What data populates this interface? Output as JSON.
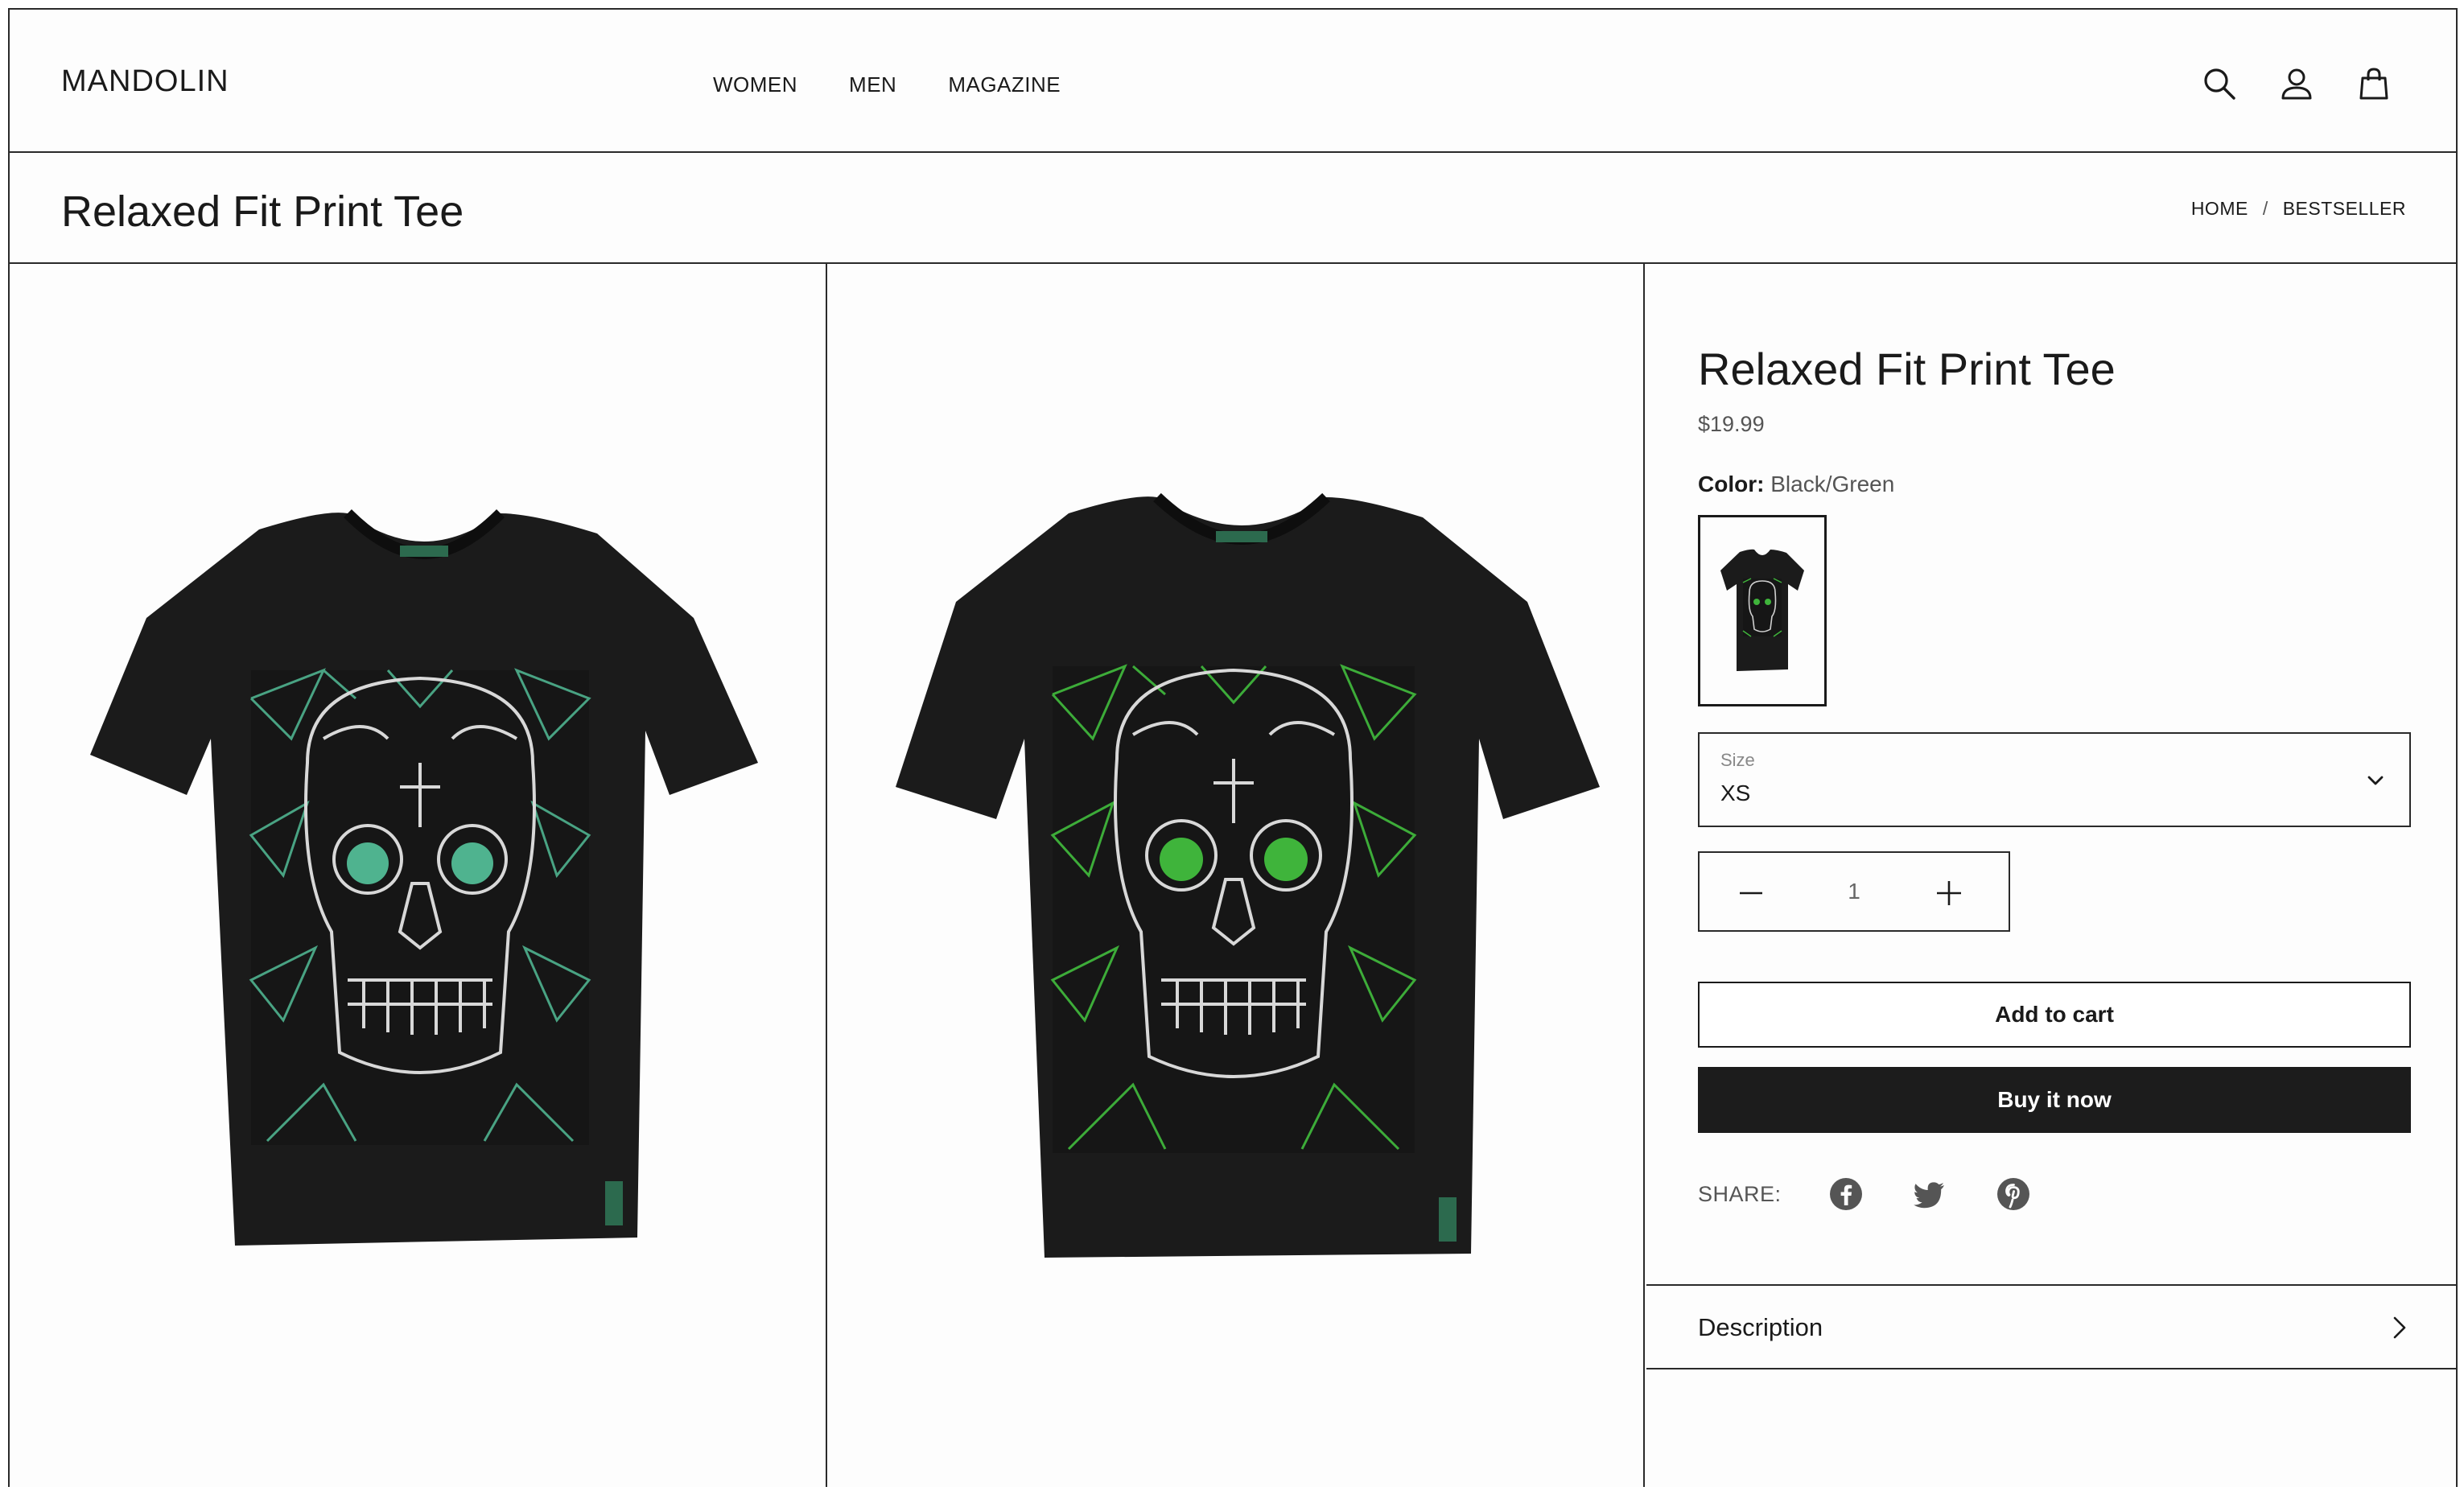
{
  "header": {
    "logo": "MANDOLIN",
    "nav": [
      "WOMEN",
      "MEN",
      "MAGAZINE"
    ],
    "icons": [
      "search-icon",
      "account-icon",
      "bag-icon"
    ]
  },
  "title_bar": {
    "title": "Relaxed Fit Print Tee",
    "breadcrumb": {
      "home": "HOME",
      "separator": "/",
      "current": "BESTSELLER"
    }
  },
  "gallery": {
    "images": [
      "t-shirt-front-teal-print",
      "t-shirt-front-green-print"
    ]
  },
  "product": {
    "title": "Relaxed Fit Print Tee",
    "price": "$19.99",
    "color_label": "Color:",
    "color_value": "Black/Green",
    "size_label": "Size",
    "size_value": "XS",
    "quantity": "1",
    "add_to_cart": "Add to cart",
    "buy_now": "Buy it now",
    "share_label": "SHARE:",
    "share_icons": [
      "facebook-icon",
      "twitter-icon",
      "pinterest-icon"
    ],
    "description_label": "Description"
  },
  "colors": {
    "border": "#2a2a2a",
    "buy_button_bg": "#1c1c1c",
    "shirt": "#1b1b1b",
    "print_teal": "#4fb38f",
    "print_green": "#3fb43b"
  }
}
